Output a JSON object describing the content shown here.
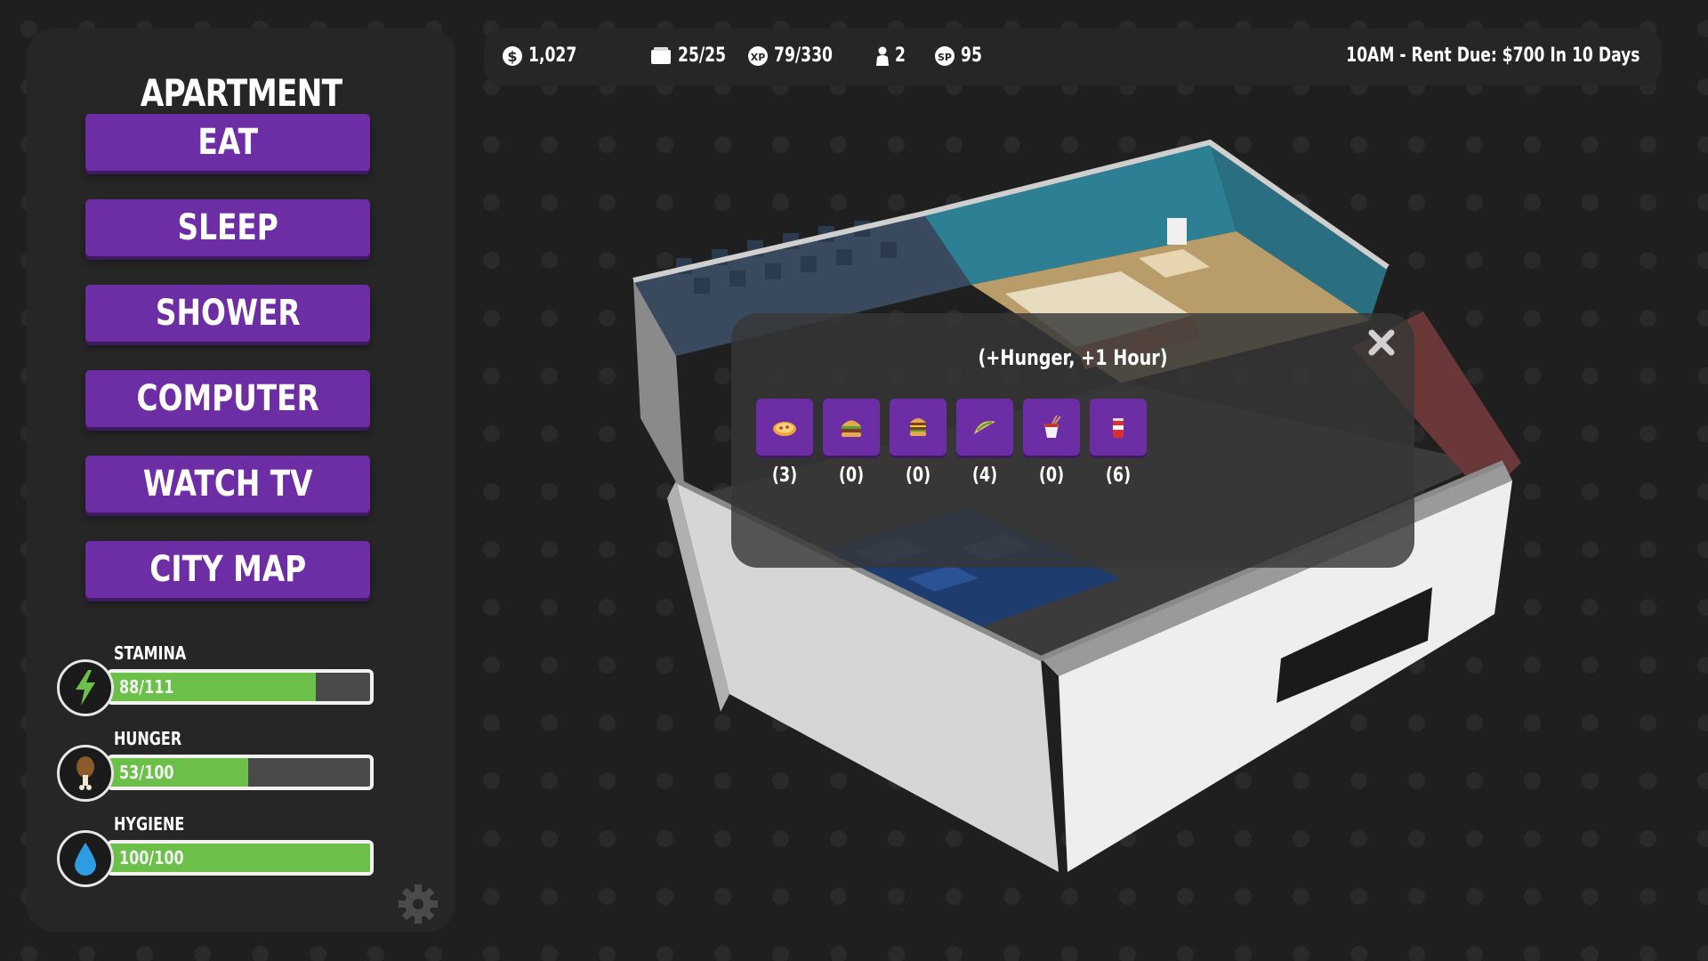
{
  "panel": {
    "title": "APARTMENT",
    "actions": [
      {
        "label": "EAT"
      },
      {
        "label": "SLEEP"
      },
      {
        "label": "SHOWER"
      },
      {
        "label": "COMPUTER"
      },
      {
        "label": "WATCH TV"
      },
      {
        "label": "CITY MAP"
      }
    ],
    "stats": [
      {
        "label": "STAMINA",
        "value_text": "88/111",
        "fraction": 0.79,
        "icon": "lightning-icon"
      },
      {
        "label": "HUNGER",
        "value_text": "53/100",
        "fraction": 0.53,
        "icon": "drumstick-icon"
      },
      {
        "label": "HYGIENE",
        "value_text": "100/100",
        "fraction": 1.0,
        "icon": "water-drop-icon"
      }
    ]
  },
  "topbar": {
    "money": "1,027",
    "cards": "25/25",
    "xp": "79/330",
    "people": "2",
    "sp": "95",
    "time_rent": "10AM - Rent Due: $700 In 10 Days"
  },
  "popup": {
    "subtitle": "(+Hunger, +1 Hour)",
    "foods": [
      {
        "icon": "pizza-icon",
        "count": "(3)"
      },
      {
        "icon": "burger-icon",
        "count": "(0)"
      },
      {
        "icon": "double-burger-icon",
        "count": "(0)"
      },
      {
        "icon": "taco-icon",
        "count": "(4)"
      },
      {
        "icon": "noodle-box-icon",
        "count": "(0)"
      },
      {
        "icon": "soda-can-icon",
        "count": "(6)"
      }
    ]
  },
  "colors": {
    "accent": "#6d2ea5",
    "bar_fill": "#6cc04a",
    "background": "#1f1f1f",
    "panel": "#262626"
  }
}
